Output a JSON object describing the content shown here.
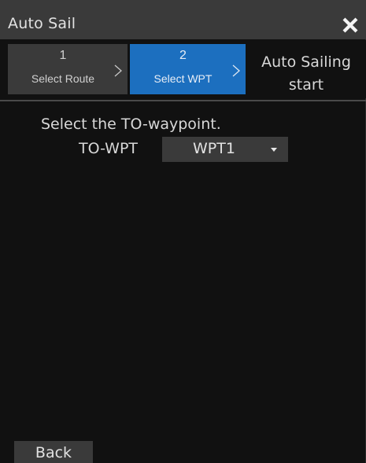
{
  "window": {
    "title": "Auto Sail",
    "close_icon": "close-icon"
  },
  "steps": [
    {
      "number": "1",
      "label": "Select Route",
      "state": "done"
    },
    {
      "number": "2",
      "label": "Select WPT",
      "state": "active"
    },
    {
      "line1": "Auto Sailing",
      "line2": "start",
      "state": "pending"
    }
  ],
  "colors": {
    "active_step": "#1c6fbf",
    "button_bg": "#3a3a3a",
    "background": "#111111"
  },
  "main": {
    "instruction": "Select the TO-waypoint.",
    "to_wpt": {
      "label": "TO-WPT",
      "value": "WPT1",
      "caret_icon": "caret-down-icon"
    }
  },
  "footer": {
    "back_label": "Back"
  }
}
